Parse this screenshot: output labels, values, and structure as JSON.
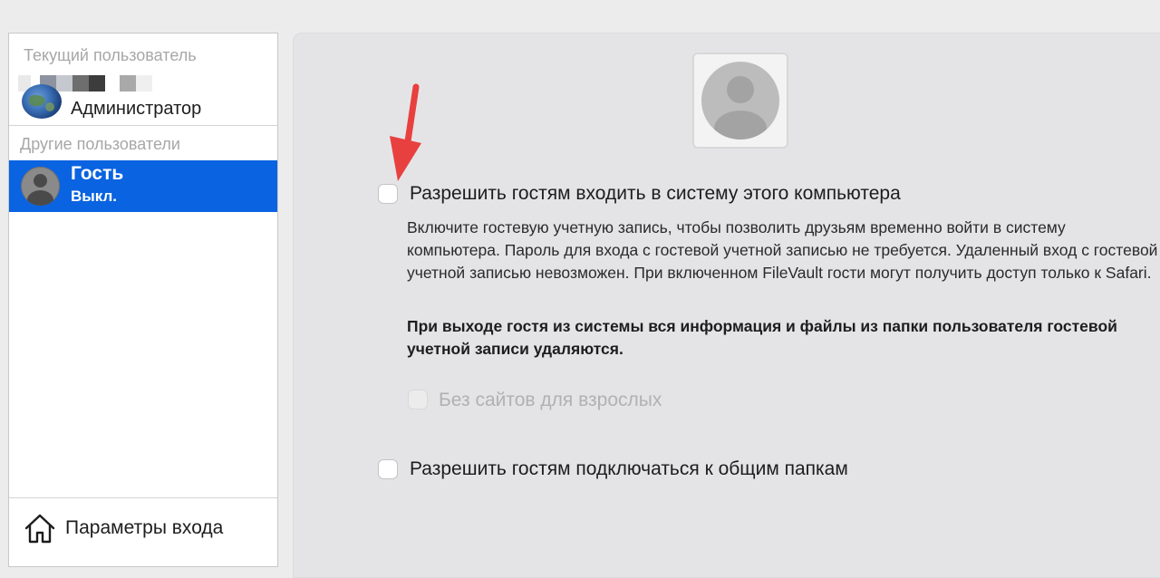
{
  "sidebar": {
    "current_header": "Текущий пользователь",
    "admin_role": "Администратор",
    "other_header": "Другие пользователи",
    "guest": {
      "name": "Гость",
      "status": "Выкл."
    },
    "login_options_label": "Параметры входа",
    "selection_color": "#0a63e0"
  },
  "main": {
    "allow_login": {
      "label": "Разрешить гостям входить в систему этого компьютера",
      "checked": false
    },
    "description": "Включите гостевую учетную запись, чтобы позволить друзьям временно войти в систему компьютера. Пароль для входа с гостевой учетной записью не требуется. Удаленный вход с гостевой учетной записью невозможен. При включенном FileVault гости могут получить доступ только к Safari.",
    "warning": "При выходе гостя из системы вся информация и файлы из папки пользователя гостевой учетной записи удаляются.",
    "parental": {
      "label": "Без сайтов для взрослых",
      "checked": false,
      "enabled": false
    },
    "shared_folders": {
      "label": "Разрешить гостям подключаться к общим папкам",
      "checked": false
    }
  },
  "annotation": {
    "arrow_color": "#e8403f",
    "icon": "red-arrow-annotation"
  }
}
